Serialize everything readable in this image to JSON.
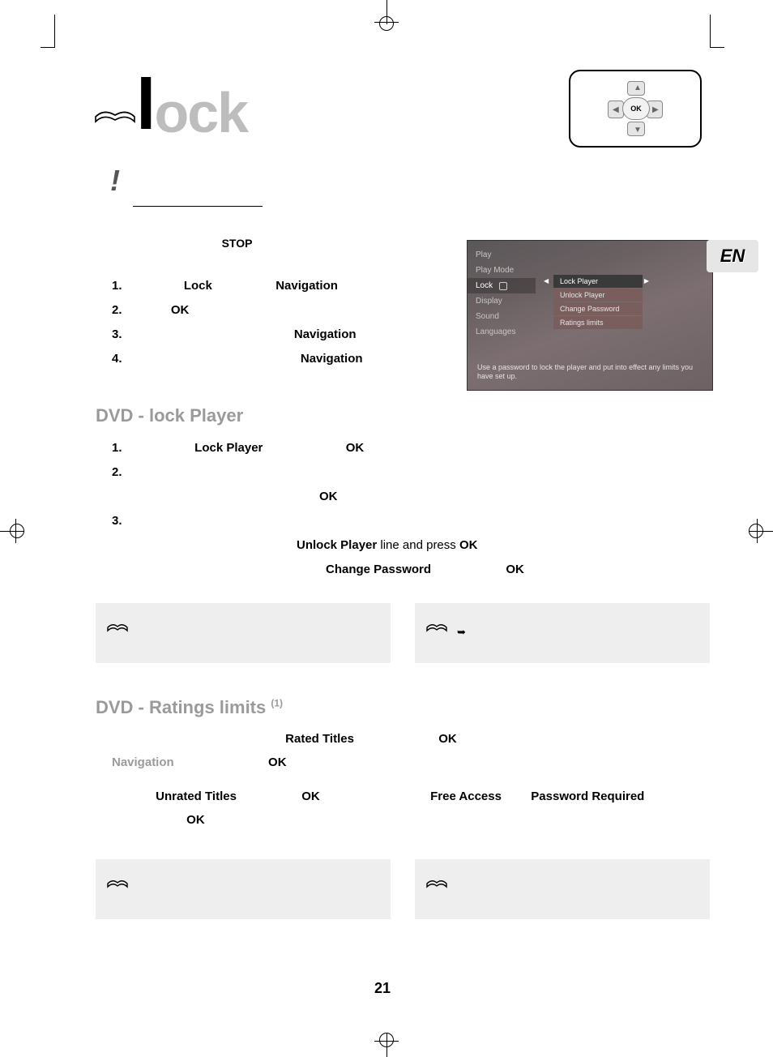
{
  "crop_marks": true,
  "title": "Lock",
  "title_letter_styled": "l",
  "title_rest": "ock",
  "navbox": {
    "center": "OK"
  },
  "language_tab": "EN",
  "intro_stop": "STOP",
  "steps_a": [
    {
      "num": "1.",
      "lock": "Lock",
      "nav": "Navigation"
    },
    {
      "num": "2.",
      "ok": "OK"
    },
    {
      "num": "3.",
      "nav": "Navigation"
    },
    {
      "num": "4.",
      "nav": "Navigation"
    }
  ],
  "screenshot": {
    "left_menu": [
      "Play",
      "Play Mode",
      "Lock",
      "Display",
      "Sound",
      "Languages"
    ],
    "selected_left": "Lock",
    "submenu": [
      "Lock Player",
      "Unlock Player",
      "Change Password",
      "Ratings limits"
    ],
    "selected_sub": "Lock Player",
    "hint": "Use a password to lock the player and put into effect any limits you have set up."
  },
  "h_lockplayer": "DVD - lock Player",
  "steps_b": {
    "r1": {
      "num": "1.",
      "lockplayer": "Lock Player",
      "ok": "OK"
    },
    "r2": {
      "num": "2.",
      "ok": "OK"
    },
    "r3": {
      "num": "3.",
      "unlock_text": "Unlock Player",
      "line_press": " line and press ",
      "ok": "OK",
      "change_pw": "Change Password",
      "ok2": "OK"
    }
  },
  "notes1": {
    "left_arrow": "",
    "right_arrow": "➥"
  },
  "h_ratings": "DVD - Ratings limits",
  "h_ratings_sup": "(1)",
  "ratings": {
    "rated_titles": "Rated Titles",
    "ok": "OK",
    "navigation": "Navigation",
    "unrated_titles": "Unrated Titles",
    "free_access": "Free Access",
    "password_required": "Password Required"
  },
  "page_number": "21"
}
